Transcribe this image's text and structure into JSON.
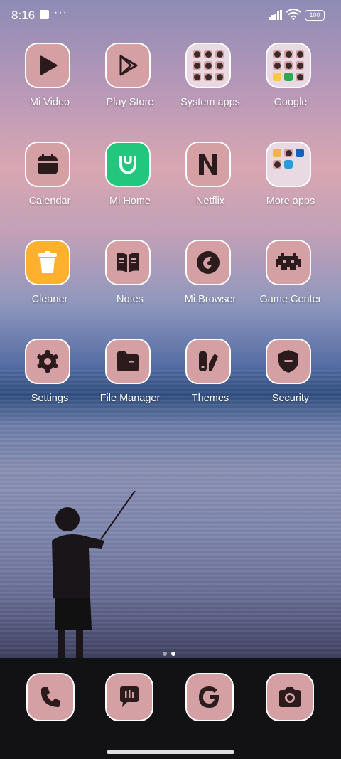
{
  "status_bar": {
    "time": "8:16",
    "battery": "100"
  },
  "apps": [
    {
      "label": "Mi Video",
      "icon": "play-icon"
    },
    {
      "label": "Play Store",
      "icon": "play-store-icon"
    },
    {
      "label": "System apps",
      "icon": "folder-icon"
    },
    {
      "label": "Google",
      "icon": "folder-icon"
    },
    {
      "label": "Calendar",
      "icon": "calendar-icon"
    },
    {
      "label": "Mi Home",
      "icon": "mi-home-icon"
    },
    {
      "label": "Netflix",
      "icon": "netflix-icon"
    },
    {
      "label": "More apps",
      "icon": "folder-icon"
    },
    {
      "label": "Cleaner",
      "icon": "trash-icon"
    },
    {
      "label": "Notes",
      "icon": "book-icon"
    },
    {
      "label": "Mi Browser",
      "icon": "browser-icon"
    },
    {
      "label": "Game Center",
      "icon": "invader-icon"
    },
    {
      "label": "Settings",
      "icon": "gear-icon"
    },
    {
      "label": "File Manager",
      "icon": "folder-file-icon"
    },
    {
      "label": "Themes",
      "icon": "brush-icon"
    },
    {
      "label": "Security",
      "icon": "shield-icon"
    }
  ],
  "dock": [
    {
      "name": "phone",
      "icon": "phone-icon"
    },
    {
      "name": "messages",
      "icon": "chat-icon"
    },
    {
      "name": "google",
      "icon": "google-g-icon"
    },
    {
      "name": "camera",
      "icon": "camera-icon"
    }
  ],
  "colors": {
    "icon_bg": "#d4a0a3",
    "icon_glyph": "#2b1b1c",
    "mi_home_bg": "#21c77c",
    "cleaner_bg": "#ffb02e"
  }
}
